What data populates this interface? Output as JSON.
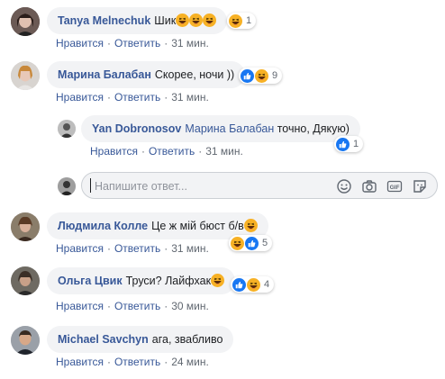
{
  "actions": {
    "like": "Нравится",
    "reply": "Ответить",
    "separator": "·"
  },
  "comments": [
    {
      "author": "Tanya Melnechuk",
      "text": "Шик",
      "reactions": [
        "haha"
      ],
      "count": "1",
      "time": "31 мин."
    },
    {
      "author": "Марина Балабан",
      "text": "Скорее, ночи ))",
      "reactions": [
        "like",
        "haha"
      ],
      "count": "9",
      "time": "31 мин."
    },
    {
      "author": "Yan Dobronosov",
      "mention": "Марина Балабан",
      "text": "точно, Дякую)",
      "reactions": [
        "like"
      ],
      "count": "1",
      "time": "31 мин."
    },
    {
      "author": "Людмила Колле",
      "text": "Це ж мій бюст б/в",
      "reactions": [
        "haha",
        "like"
      ],
      "count": "5",
      "time": "31 мин."
    },
    {
      "author": "Ольга Цвик",
      "text": "Труси? Лайфхак",
      "reactions": [
        "like",
        "haha"
      ],
      "count": "4",
      "time": "30 мин."
    },
    {
      "author": "Michael Savchyn",
      "text": "ага, звабливо",
      "time": "24 мин."
    }
  ],
  "reply_box": {
    "placeholder": "Напишите ответ...",
    "tools": [
      "emoji-icon",
      "camera-icon",
      "gif-icon",
      "sticker-icon"
    ]
  },
  "colors": {
    "link": "#385898",
    "bubble": "#f2f3f5",
    "meta": "#606770",
    "like_blue": "#1877f2",
    "haha_yellow": "#f7b125"
  }
}
